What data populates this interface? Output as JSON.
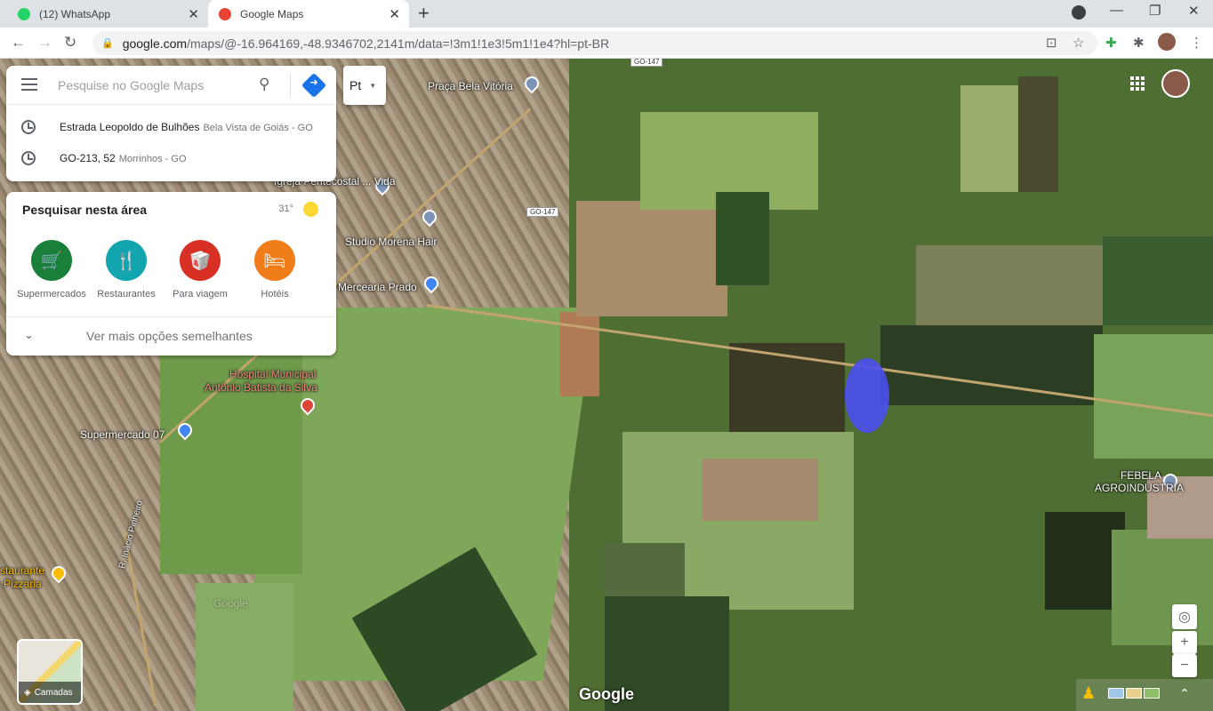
{
  "browser": {
    "tabs": [
      {
        "title": "(12) WhatsApp",
        "favicon_color": "#25d366",
        "active": false
      },
      {
        "title": "Google Maps",
        "favicon_color": "#ea4335",
        "active": true
      }
    ],
    "new_tab": "+",
    "window_controls": {
      "minimize": "—",
      "restore": "❐",
      "close": "✕"
    },
    "url_host": "google.com",
    "url_path": "/maps/@-16.964169,-48.9346702,2141m/data=!3m1!1e3!5m1!1e4?hl=pt-BR"
  },
  "search": {
    "placeholder": "Pesquise no Google Maps",
    "recent": [
      {
        "primary": "Estrada Leopoldo de Bulhões",
        "secondary": "Bela Vista de Goiás - GO"
      },
      {
        "primary": "GO-213, 52",
        "secondary": "Morrinhos - GO"
      }
    ]
  },
  "language_button": "Pt",
  "area_panel": {
    "title": "Pesquisar nesta área",
    "weather": "31°",
    "categories": [
      {
        "label": "Supermercados",
        "icon": "cart-icon",
        "glyph": "🛒",
        "color": "#188038"
      },
      {
        "label": "Restaurantes",
        "icon": "fork-knife-icon",
        "glyph": "🍴",
        "color": "#12a4af"
      },
      {
        "label": "Para viagem",
        "icon": "takeout-icon",
        "glyph": "🥡",
        "color": "#d93025"
      },
      {
        "label": "Hotéis",
        "icon": "bed-icon",
        "glyph": "🛏",
        "color": "#f17d1a"
      }
    ],
    "more_label": "Ver mais opções semelhantes"
  },
  "map_labels": [
    {
      "text": "Praça Bela Vitória"
    },
    {
      "text": "Igreja Pentecostal ... Vida"
    },
    {
      "text": "Studio Morena Hair"
    },
    {
      "text": "Mercearia Prado"
    },
    {
      "text": "Hospital Municipal"
    },
    {
      "text": "Antônio Batista da Silva"
    },
    {
      "text": "Supermercado 07"
    },
    {
      "text": "R. Inácio Pinheiro"
    },
    {
      "text": "FEBELA"
    },
    {
      "text": "AGROINDUSTRIA"
    },
    {
      "text": "staurante"
    },
    {
      "text": "Pizzaria"
    },
    {
      "text": "Google"
    }
  ],
  "road_shields": [
    "GO-147",
    "GO-147"
  ],
  "map_controls": {
    "zoom_in": "+",
    "zoom_out": "−",
    "locate": "◎",
    "expand": "⌃"
  },
  "layers_label": "Camadas",
  "google_logo": "Google"
}
